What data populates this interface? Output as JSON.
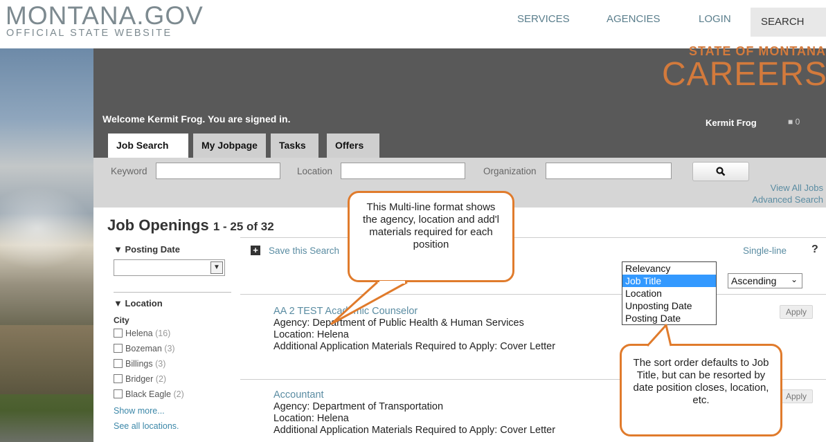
{
  "site": {
    "logo_main": "MONTANA.GOV",
    "logo_sub": "OFFICIAL STATE WEBSITE",
    "nav": {
      "services": "SERVICES",
      "agencies": "AGENCIES",
      "login": "LOGIN",
      "search": "SEARCH"
    }
  },
  "banner": {
    "state": "STATE OF MONTANA",
    "careers": "CAREERS",
    "welcome": "Welcome Kermit Frog. You are signed in.",
    "user_name": "Kermit Frog",
    "cart_count": "0",
    "tabs": [
      {
        "label": "Job Search",
        "active": true
      },
      {
        "label": "My Jobpage",
        "active": false
      },
      {
        "label": "Tasks",
        "active": false
      },
      {
        "label": "Offers",
        "active": false
      }
    ]
  },
  "search": {
    "keyword_label": "Keyword",
    "keyword_value": "",
    "location_label": "Location",
    "location_value": "",
    "organization_label": "Organization",
    "organization_value": "",
    "button_icon": "search-icon",
    "view_all": "View All Jobs",
    "advanced": "Advanced Search"
  },
  "results": {
    "heading": "Job Openings",
    "count": "1 - 25 of 32",
    "save_search": "Save this Search",
    "single_line": "Single-line",
    "help": "?",
    "order_value": "Ascending",
    "sort_options": [
      "Relevancy",
      "Job Title",
      "Location",
      "Unposting Date",
      "Posting Date"
    ],
    "sort_selected": "Job Title",
    "apply_label": "Apply",
    "jobs": [
      {
        "title": "AA 2 TEST Academic Counselor",
        "agency": "Agency: Department of Public Health & Human Services",
        "location": "Location: Helena",
        "materials": "Additional Application Materials Required to Apply: Cover Letter"
      },
      {
        "title": "Accountant",
        "agency": "Agency: Department of Transportation",
        "location": "Location: Helena",
        "materials": "Additional Application Materials Required to Apply: Cover Letter"
      }
    ]
  },
  "facets": {
    "posting_date_title": "Posting Date",
    "posting_date_value": "",
    "location_title": "Location",
    "city_title": "City",
    "cities": [
      {
        "name": "Helena",
        "count": "(16)"
      },
      {
        "name": "Bozeman",
        "count": "(3)"
      },
      {
        "name": "Billings",
        "count": "(3)"
      },
      {
        "name": "Bridger",
        "count": "(2)"
      },
      {
        "name": "Black Eagle",
        "count": "(2)"
      }
    ],
    "show_more": "Show more...",
    "see_all": "See all locations."
  },
  "callouts": {
    "multi_line": "This Multi-line format shows the agency, location and add'l materials required for each position",
    "sort_order": "The sort order defaults to Job Title, but can be resorted by date position closes, location, etc."
  },
  "colors": {
    "accent": "#d37a3c",
    "banner": "#595959",
    "link": "#5a8ca2",
    "callout_border": "#e07b2c",
    "selected": "#3399ff"
  }
}
